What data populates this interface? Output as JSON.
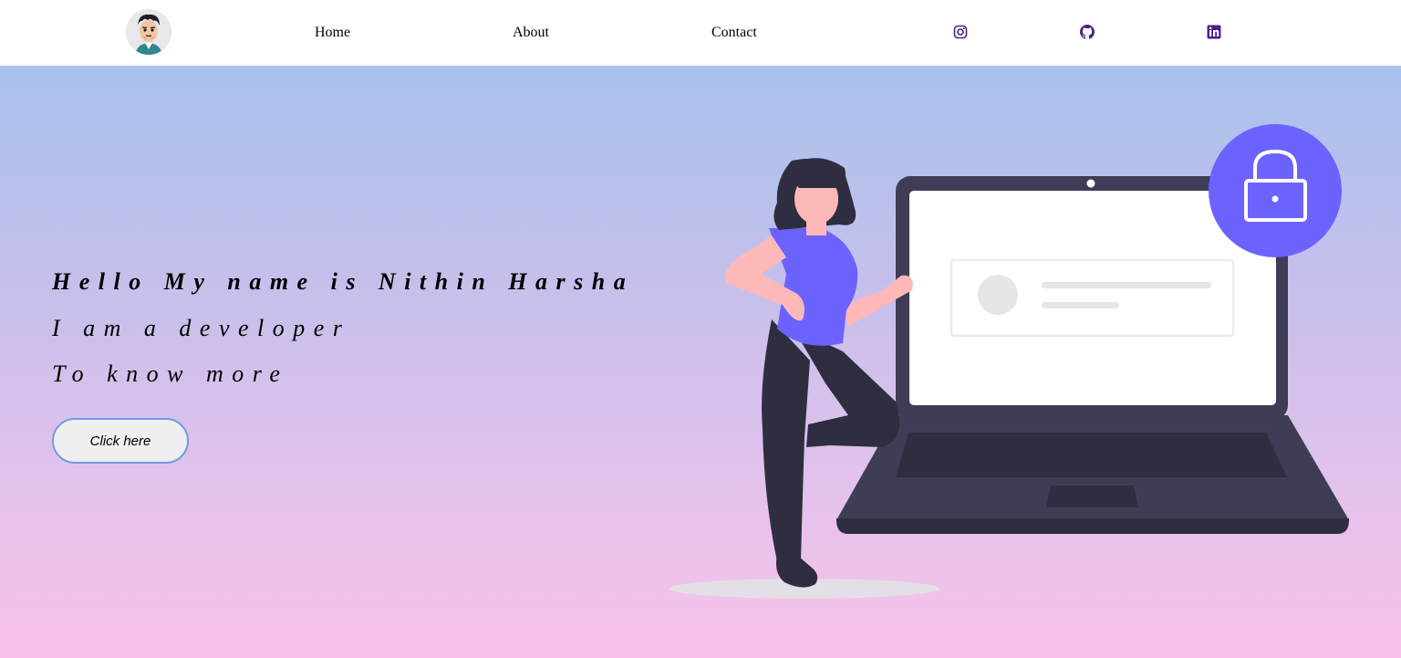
{
  "nav": {
    "links": [
      {
        "label": "Home"
      },
      {
        "label": "About"
      },
      {
        "label": "Contact"
      }
    ],
    "social": [
      {
        "icon": "instagram-icon"
      },
      {
        "icon": "github-icon"
      },
      {
        "icon": "linkedin-icon"
      }
    ],
    "icon_color": "#4b1f8c"
  },
  "hero": {
    "title": "Hello My name is Nithin Harsha",
    "line1": "I am a developer",
    "line2": "To know more",
    "button_label": "Click here"
  },
  "colors": {
    "gradient_top": "#a9c1ed",
    "gradient_bottom": "#f9c1e9",
    "accent": "#6c63ff",
    "laptop": "#3f3d56",
    "button_border": "#6e9ae6"
  }
}
